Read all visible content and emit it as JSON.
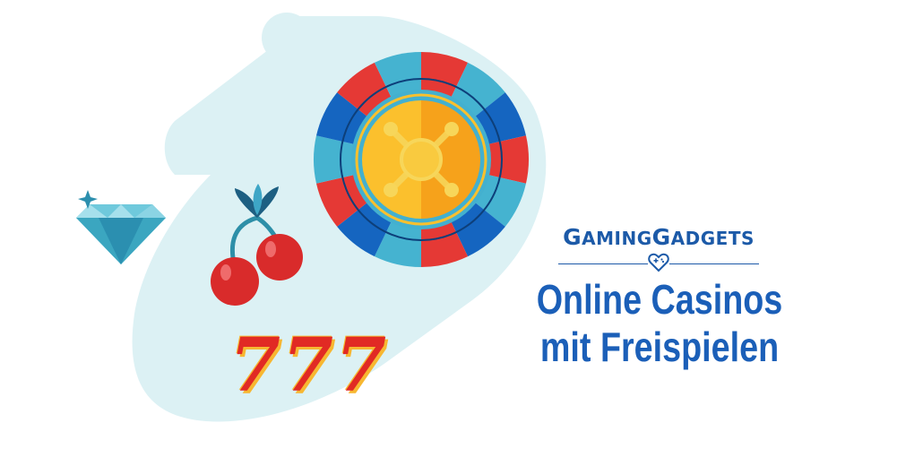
{
  "brand": {
    "prefix_a": "G",
    "name_a": "AMING",
    "prefix_b": "G",
    "name_b": "ADGETS",
    "logo_icon": "gamepad-heart-icon"
  },
  "headline": {
    "line1": "Online Casinos",
    "line2": "mit Freispielen"
  },
  "slot_symbol": {
    "text": "777"
  },
  "illustration": {
    "icons": [
      "diamond-icon",
      "cherries-icon",
      "roulette-wheel-icon",
      "sevens-icon"
    ]
  },
  "colors": {
    "brand_blue": "#1b5fb8",
    "backdrop": "#dcf1f4",
    "wheel_red": "#e53935",
    "wheel_blue": "#1565c0",
    "wheel_teal": "#45b3d0",
    "wheel_gold": "#fbc02d",
    "cherry_red": "#d92b2b"
  }
}
